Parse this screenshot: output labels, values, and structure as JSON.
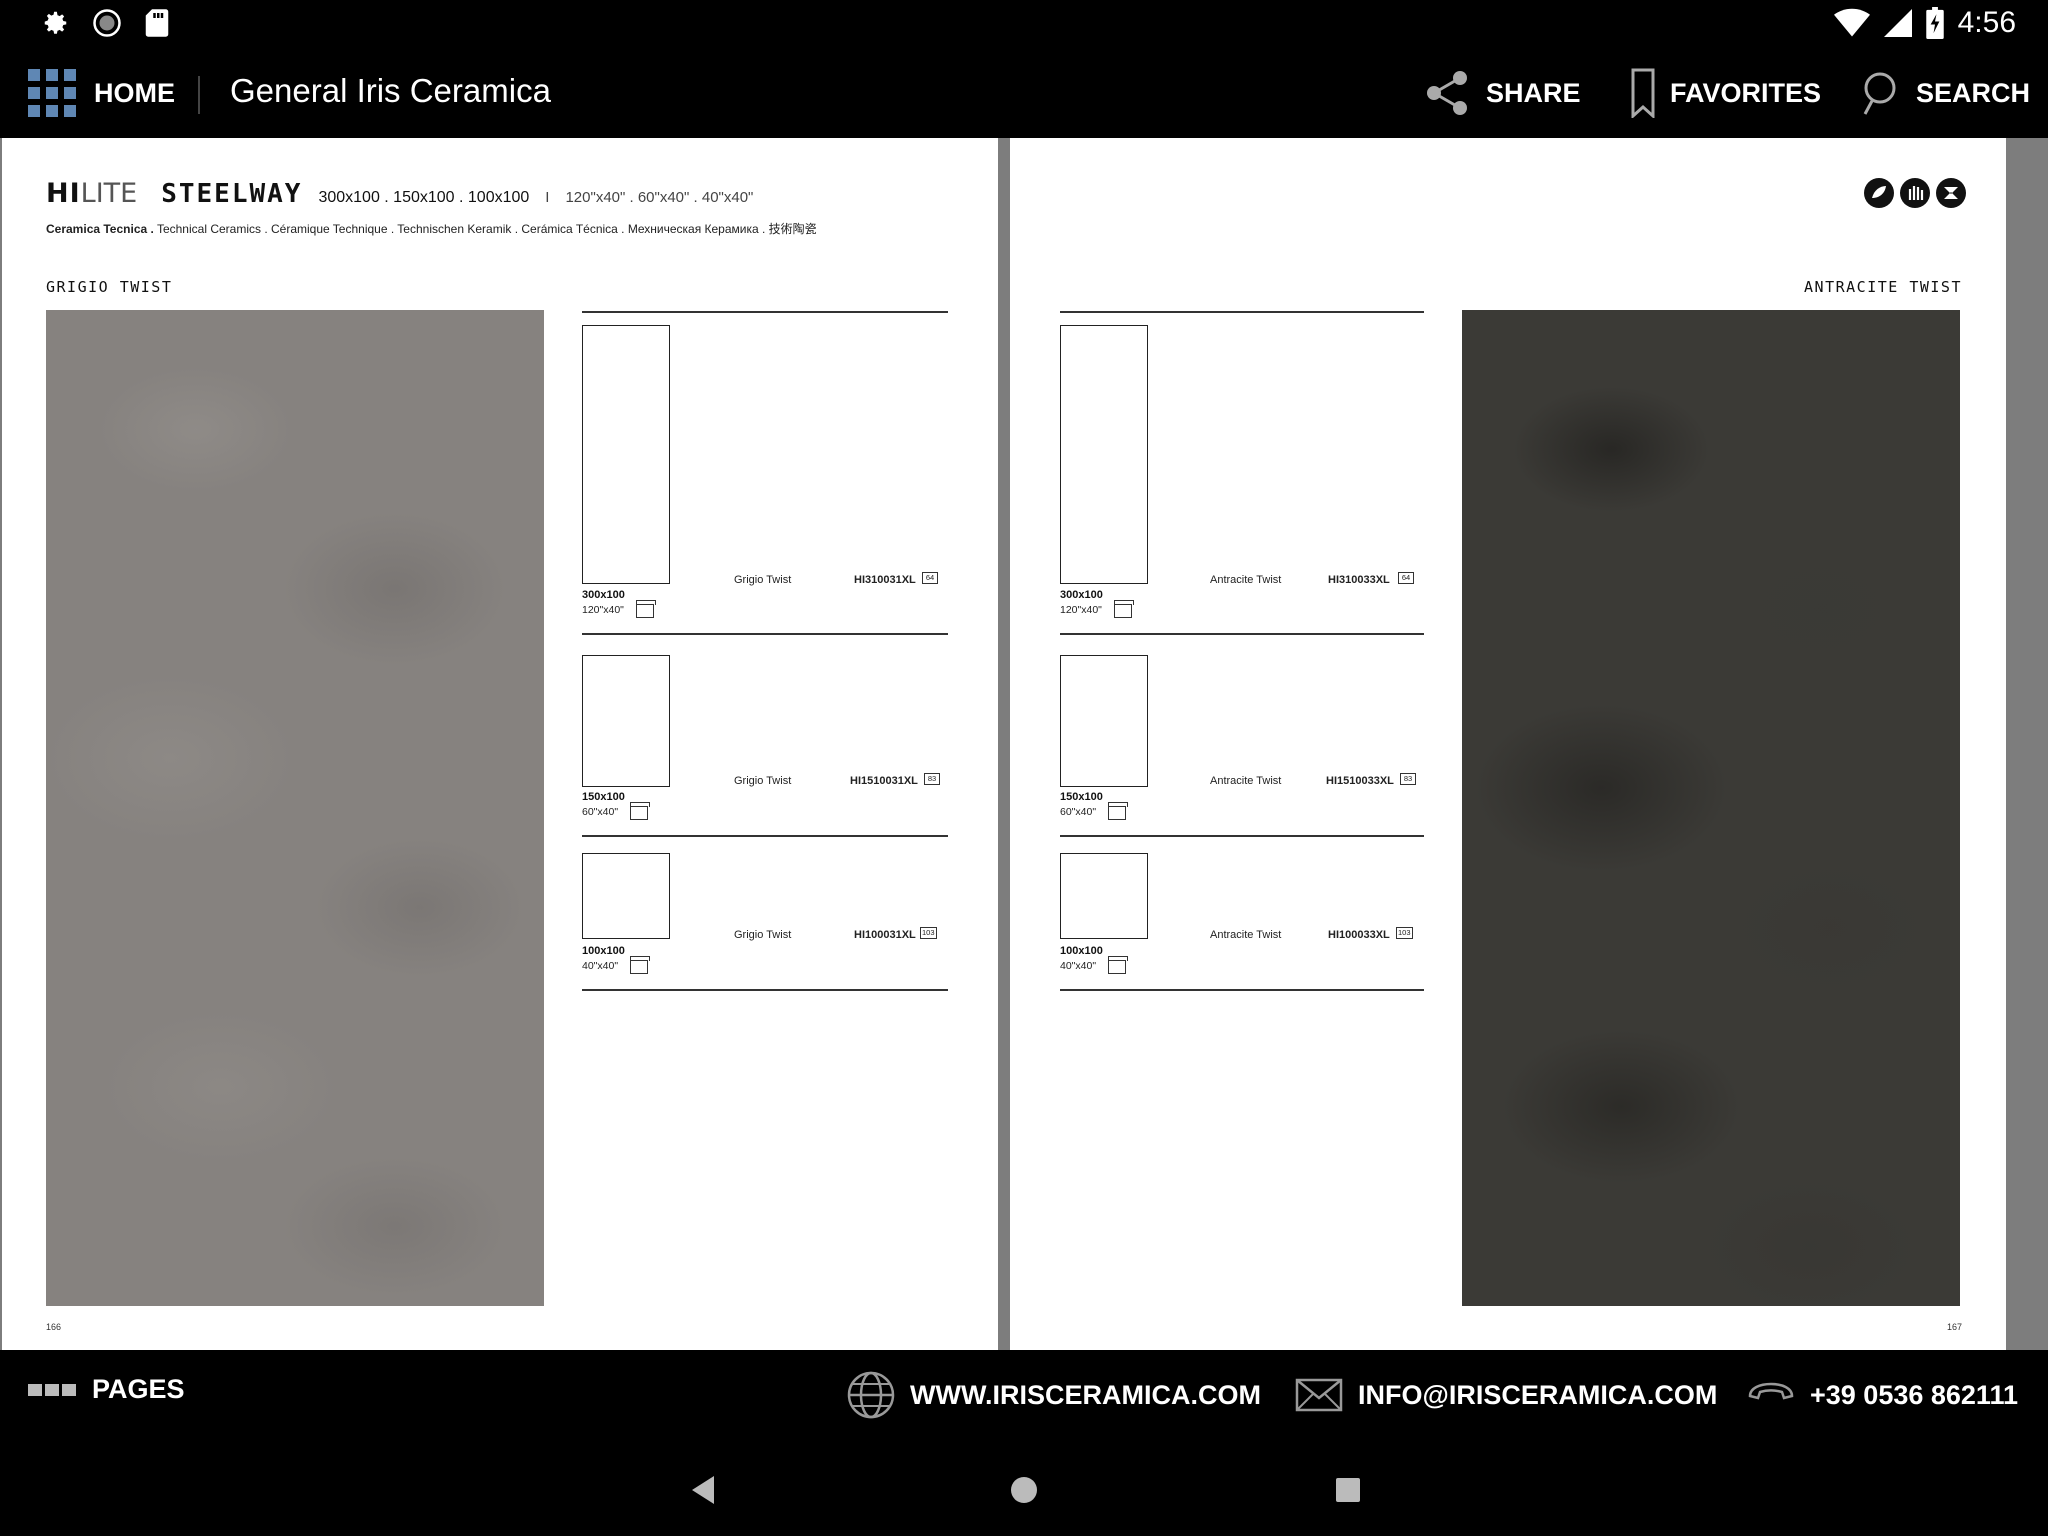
{
  "status_bar": {
    "time": "4:56",
    "left_icons": [
      "settings-icon",
      "sync-icon",
      "sd-card-icon"
    ],
    "right_icons": [
      "wifi-icon",
      "signal-icon",
      "battery-charging-icon"
    ]
  },
  "app_bar": {
    "home_label": "HOME",
    "title": "General Iris Ceramica",
    "share_label": "SHARE",
    "favorites_label": "FAVORITES",
    "search_label": "SEARCH"
  },
  "left_page": {
    "brand_hi": "HI",
    "brand_lite": "LITE",
    "brand_name": "STEELWAY",
    "sizes": "300x100 . 150x100 . 100x100",
    "separator": "I",
    "sizes_inches": "120\"x40\" . 60\"x40\" . 40\"x40\"",
    "subline_bold": "Ceramica Tecnica .",
    "subline_rest": " Technical Ceramics . Céramique Technique . Technischen Keramik . Cerámica Técnica . Mехническая Керамика . 技術陶瓷",
    "variant_title": "GRIGIO TWIST",
    "page_number": "166",
    "rows": [
      {
        "size": "300x100",
        "size_in": "120\"x40\"",
        "box": "1",
        "name": "Grigio Twist",
        "code": "HI310031XL",
        "pcs": "64"
      },
      {
        "size": "150x100",
        "size_in": "60\"x40\"",
        "box": "1",
        "name": "Grigio Twist",
        "code": "HI1510031XL",
        "pcs": "83"
      },
      {
        "size": "100x100",
        "size_in": "40\"x40\"",
        "box": "2",
        "name": "Grigio Twist",
        "code": "HI100031XL",
        "pcs": "103"
      }
    ]
  },
  "right_page": {
    "variant_title": "ANTRACITE TWIST",
    "page_number": "167",
    "eco_icons": [
      "leaf-badge-icon",
      "hand-badge-icon",
      "bacteria-badge-icon"
    ],
    "rows": [
      {
        "size": "300x100",
        "size_in": "120\"x40\"",
        "box": "1",
        "name": "Antracite Twist",
        "code": "HI310033XL",
        "pcs": "64"
      },
      {
        "size": "150x100",
        "size_in": "60\"x40\"",
        "box": "1",
        "name": "Antracite Twist",
        "code": "HI1510033XL",
        "pcs": "83"
      },
      {
        "size": "100x100",
        "size_in": "40\"x40\"",
        "box": "2",
        "name": "Antracite Twist",
        "code": "HI100033XL",
        "pcs": "103"
      }
    ]
  },
  "bottom_bar": {
    "pages_label": "PAGES",
    "website": "WWW.IRISCERAMICA.COM",
    "email": "INFO@IRISCERAMICA.COM",
    "phone": "+39 0536 862111"
  }
}
